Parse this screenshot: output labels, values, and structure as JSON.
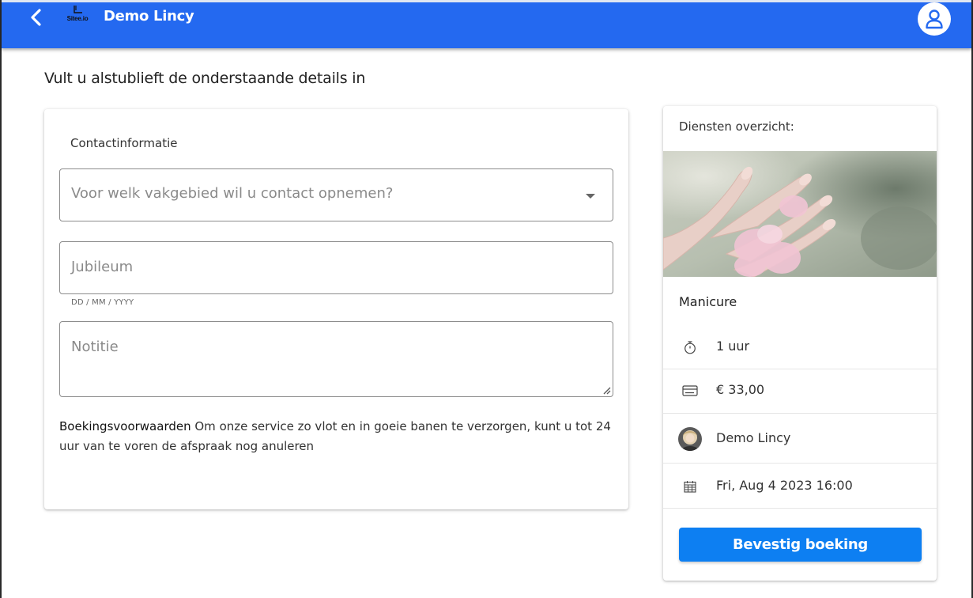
{
  "header": {
    "app_title": "Demo Lincy",
    "logo_text": "Sitee.io",
    "accent_color": "#2469f0"
  },
  "page": {
    "heading": "Vult u alstublieft de onderstaande details in"
  },
  "form": {
    "section_label": "Contactinformatie",
    "topic_select_placeholder": "Voor welk vakgebied wil u contact opnemen?",
    "anniversary_placeholder": "Jubileum",
    "anniversary_hint": "DD / MM / YYYY",
    "note_placeholder": "Notitie",
    "terms_title": "Boekingsvoorwaarden",
    "terms_text": " Om onze service zo vlot en in goeie banen te verzorgen, kunt u tot 24 uur van te voren de afspraak nog anuleren"
  },
  "summary": {
    "title": "Diensten overzicht:",
    "service_name": "Manicure",
    "duration": "1 uur",
    "price": "€ 33,00",
    "staff_name": "Demo Lincy",
    "datetime": "Fri, Aug 4 2023 16:00",
    "confirm_label": "Bevestig boeking",
    "confirm_color": "#0d7ff2",
    "icons": {
      "duration": "stopwatch-icon",
      "price": "credit-card-icon",
      "staff": "staff-avatar",
      "date": "calendar-icon"
    }
  }
}
